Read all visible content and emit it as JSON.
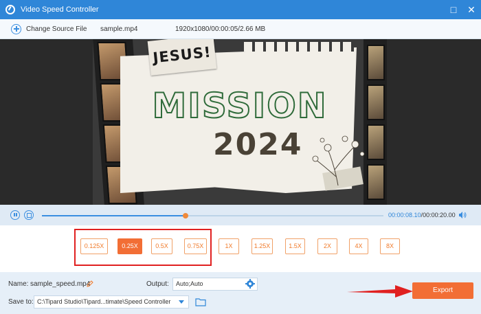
{
  "window": {
    "title": "Video Speed Controller",
    "minimize": "□",
    "close": "✕"
  },
  "source": {
    "change_label": "Change Source File",
    "file_name": "sample.mp4",
    "file_info": "1920x1080/00:00:05/2.66 MB"
  },
  "poster": {
    "tag": "JESUS!",
    "heading": "MISSION",
    "year": "2024"
  },
  "playback": {
    "current_time": "00:00:08.10",
    "separator": "/",
    "total_time": "00:00:20.00",
    "progress": 0.42
  },
  "speeds": [
    {
      "label": "0.125X",
      "active": false
    },
    {
      "label": "0.25X",
      "active": true
    },
    {
      "label": "0.5X",
      "active": false
    },
    {
      "label": "0.75X",
      "active": false
    },
    {
      "label": "1X",
      "active": false
    },
    {
      "label": "1.25X",
      "active": false
    },
    {
      "label": "1.5X",
      "active": false
    },
    {
      "label": "2X",
      "active": false
    },
    {
      "label": "4X",
      "active": false
    },
    {
      "label": "8X",
      "active": false
    }
  ],
  "output": {
    "name_label": "Name:",
    "name_value": "sample_speed.mp4",
    "output_label": "Output:",
    "output_value": "Auto;Auto",
    "save_label": "Save to:",
    "save_value": "C:\\Tipard Studio\\Tipard...timate\\Speed Controller",
    "export_label": "Export"
  },
  "colors": {
    "accent": "#2f86d8",
    "orange": "#f26e35",
    "annotation": "#e02020"
  }
}
